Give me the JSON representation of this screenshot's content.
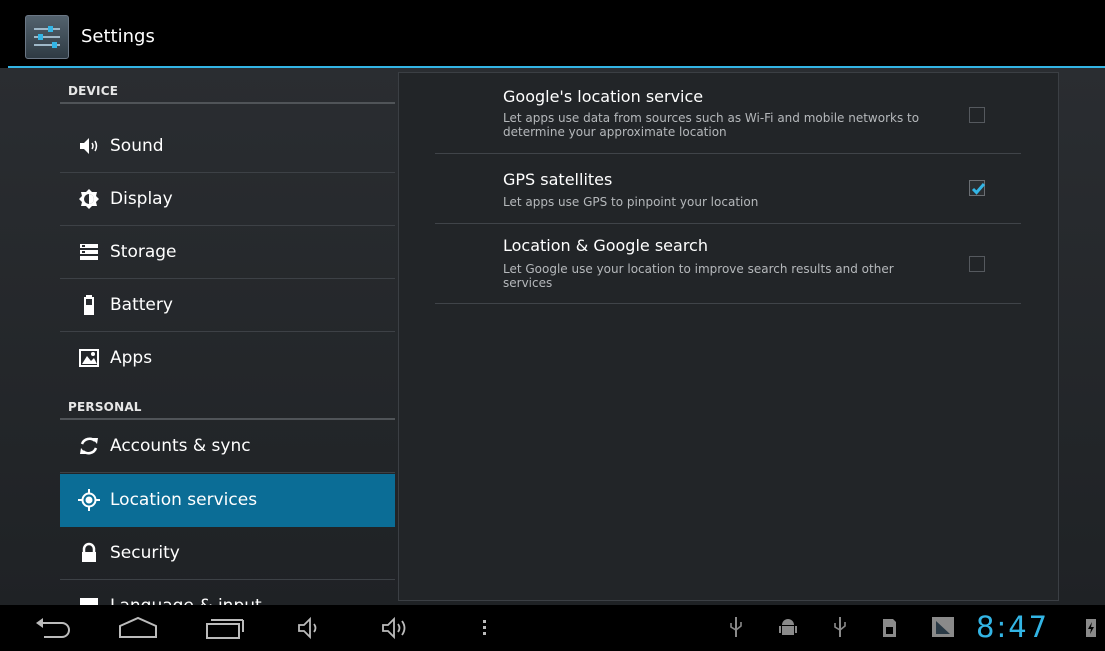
{
  "app": {
    "title": "Settings",
    "icon": "settings-sliders-icon"
  },
  "sidebar": {
    "sections": [
      {
        "header": "DEVICE"
      },
      {
        "header": "PERSONAL"
      }
    ],
    "items": [
      {
        "label": "Sound",
        "icon": "speaker-icon"
      },
      {
        "label": "Display",
        "icon": "brightness-icon"
      },
      {
        "label": "Storage",
        "icon": "storage-icon"
      },
      {
        "label": "Battery",
        "icon": "battery-icon"
      },
      {
        "label": "Apps",
        "icon": "apps-icon"
      },
      {
        "label": "Accounts & sync",
        "icon": "sync-icon"
      },
      {
        "label": "Location services",
        "icon": "location-icon",
        "selected": true
      },
      {
        "label": "Security",
        "icon": "lock-icon"
      },
      {
        "label": "Language & input",
        "icon": "keyboard-icon"
      }
    ]
  },
  "location": {
    "prefs": [
      {
        "title": "Google's location service",
        "summary": "Let apps use data from sources such as Wi-Fi and mobile networks to determine your approximate location",
        "checked": false
      },
      {
        "title": "GPS satellites",
        "summary": "Let apps use GPS to pinpoint your location",
        "checked": true
      },
      {
        "title": "Location & Google search",
        "summary": "Let Google use your location to improve search results and other services",
        "checked": false
      }
    ]
  },
  "navbar": {
    "buttons": [
      "back-icon",
      "home-icon",
      "recent-apps-icon",
      "volume-down-icon",
      "volume-up-icon",
      "menu-icon"
    ],
    "status_icons": [
      "usb-icon",
      "android-debug-icon",
      "usb-icon",
      "sd-card-icon",
      "signal-icon"
    ],
    "clock": "8:47"
  },
  "colors": {
    "accent": "#33b5e5",
    "selected": "#0b6d96"
  }
}
